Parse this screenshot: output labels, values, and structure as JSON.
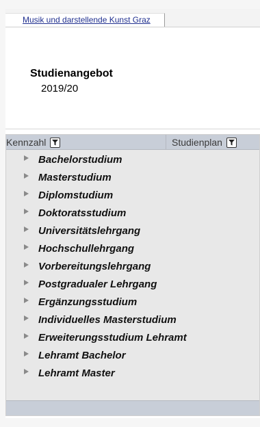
{
  "tab": {
    "label": "Musik und darstellende Kunst Graz"
  },
  "header": {
    "title": "Studienangebot",
    "year": "2019/20"
  },
  "grid": {
    "columns": [
      {
        "label": "Kennzahl",
        "icon": "filter-icon"
      },
      {
        "label": "Studienplan",
        "icon": "filter-icon"
      }
    ],
    "items": [
      "Bachelorstudium",
      "Masterstudium",
      "Diplomstudium",
      "Doktoratsstudium",
      "Universitätslehrgang",
      "Hochschullehrgang",
      "Vorbereitungslehrgang",
      "Postgradualer Lehrgang",
      "Ergänzungsstudium",
      "Individuelles Masterstudium",
      "Erweiterungsstudium Lehramt",
      "Lehramt Bachelor",
      "Lehramt Master"
    ]
  },
  "colors": {
    "link": "#1f2f8f",
    "grid_bg": "#e8e8e8",
    "header_bg": "#c8ced8"
  }
}
